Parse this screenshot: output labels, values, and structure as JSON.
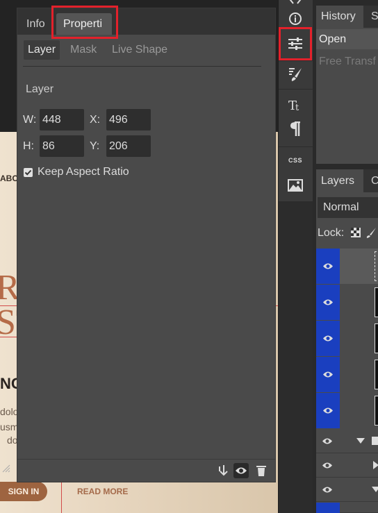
{
  "document": {
    "text_abo": "ABO",
    "text_big_r": "RI",
    "text_big_s": "ST",
    "text_nc": "NC",
    "text_body1": "dolo",
    "text_body1b": "usm",
    "text_body2": "do",
    "sign_in": "SIGN IN",
    "read_more": "READ MORE"
  },
  "properties": {
    "tabs": {
      "info": "Info",
      "properties": "Properti"
    },
    "subtabs": {
      "layer": "Layer",
      "mask": "Mask",
      "live_shape": "Live Shape"
    },
    "section_title": "Layer",
    "fields": {
      "w_label": "W:",
      "w_value": "448",
      "x_label": "X:",
      "x_value": "496",
      "h_label": "H:",
      "h_value": "86",
      "y_label": "Y:",
      "y_value": "206"
    },
    "keep_aspect_label": "Keep Aspect Ratio",
    "keep_aspect_checked": true
  },
  "tools": {
    "icons": [
      "info-icon",
      "adjustments-icon",
      "brush-settings-icon",
      "character-icon",
      "paragraph-icon",
      "css-icon",
      "image-icon"
    ],
    "css_label": "CSS"
  },
  "history": {
    "tabs": {
      "history": "History",
      "swatches": "S"
    },
    "items": [
      "Open",
      "Free Transf"
    ]
  },
  "layers": {
    "tabs": {
      "layers": "Layers",
      "channels": "C"
    },
    "blend_mode": "Normal",
    "lock_label": "Lock:"
  },
  "colors": {
    "highlight": "#e3212b",
    "selected_layer": "#1a3fbf",
    "accent_button": "#9e6440"
  }
}
